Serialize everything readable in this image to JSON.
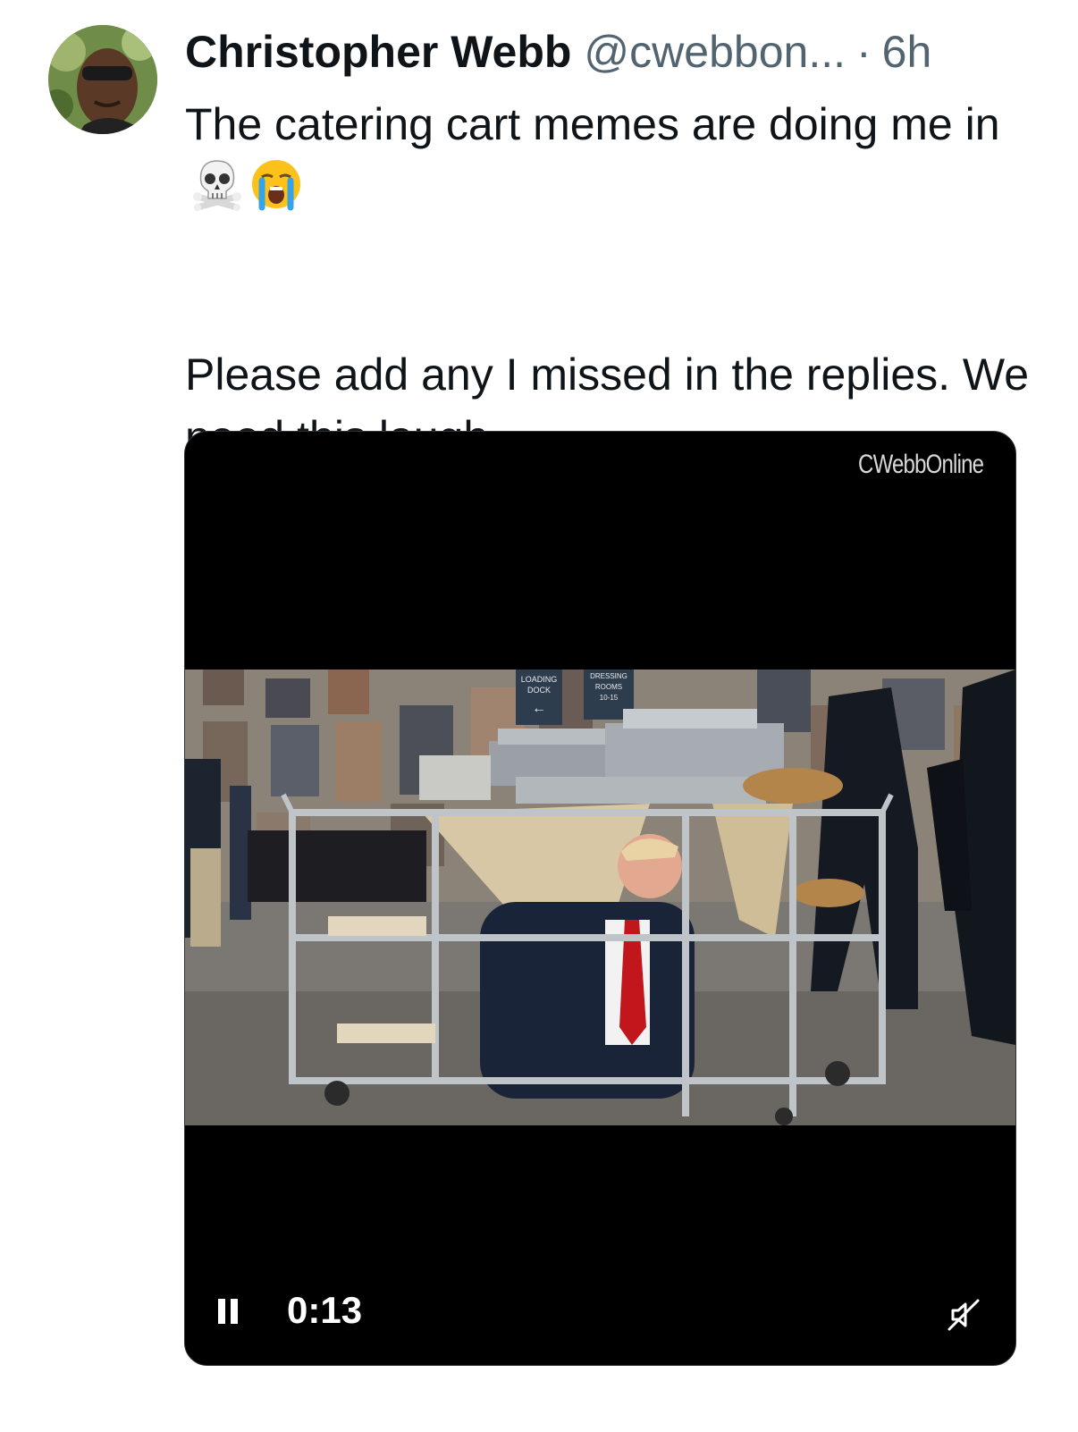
{
  "tweet": {
    "author": {
      "display_name": "Christopher Webb",
      "handle": "@cwebbon...",
      "separator": "·",
      "time_ago": "6h"
    },
    "text_line_1": "The catering cart memes are doing me in",
    "emojis": [
      "skull-and-crossbones",
      "loudly-crying-face"
    ],
    "text_paragraph_2": "Please add any I missed in the replies. We need this laugh."
  },
  "media": {
    "watermark": "CWebbOnline",
    "sign_loading_dock": "LOADING DOCK",
    "sign_dressing_rooms": "DRESSING ROOMS 10-15",
    "player": {
      "state_icon": "pause-icon",
      "current_time": "0:13",
      "sound_icon": "muted-speaker-icon"
    }
  }
}
